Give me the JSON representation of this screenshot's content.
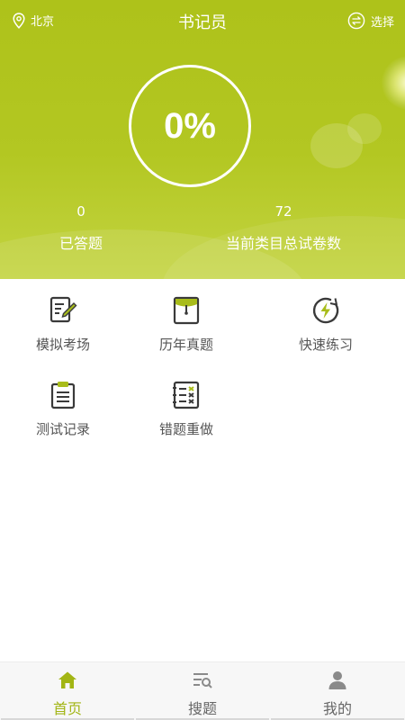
{
  "header": {
    "location": "北京",
    "title": "书记员",
    "select_label": "选择"
  },
  "progress": {
    "text": "0%",
    "value": 0
  },
  "stats": {
    "answered": {
      "value": "0",
      "label": "已答题"
    },
    "total": {
      "value": "72",
      "label": "当前类目总试卷数"
    }
  },
  "menu": [
    {
      "label": "模拟考场",
      "icon": "exam-edit-icon"
    },
    {
      "label": "历年真题",
      "icon": "past-papers-folder-icon"
    },
    {
      "label": "快速练习",
      "icon": "lightning-icon"
    },
    {
      "label": "测试记录",
      "icon": "clipboard-icon"
    },
    {
      "label": "错题重做",
      "icon": "wrong-answers-list-icon"
    }
  ],
  "nav": [
    {
      "label": "首页",
      "icon": "home-icon",
      "active": true
    },
    {
      "label": "搜题",
      "icon": "search-list-icon",
      "active": false
    },
    {
      "label": "我的",
      "icon": "user-icon",
      "active": false
    }
  ],
  "colors": {
    "accent": "#a2b514",
    "hero": "#b1c51f",
    "icon_dark": "#3a3a3a",
    "icon_green": "#a8bc1a"
  }
}
